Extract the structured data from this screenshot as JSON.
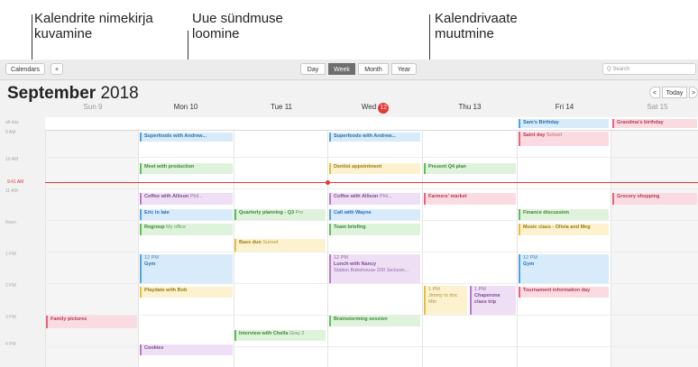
{
  "callouts": {
    "calendars_list": "Kalendrite nimekirja kuvamine",
    "new_event": "Uue sündmuse loomine",
    "change_view": "Kalendrivaate muutmine"
  },
  "toolbar": {
    "calendars_label": "Calendars",
    "add_label": "+",
    "views": [
      "Day",
      "Week",
      "Month",
      "Year"
    ],
    "active_view": "Week",
    "search_placeholder": "Q Search"
  },
  "header": {
    "month": "September",
    "year": "2018",
    "today_label": "Today",
    "prev_label": "<",
    "next_label": ">"
  },
  "days": [
    {
      "label": "Sun 9"
    },
    {
      "label": "Mon 10"
    },
    {
      "label": "Tue 11"
    },
    {
      "label": "Wed",
      "badge": "12"
    },
    {
      "label": "Thu 13"
    },
    {
      "label": "Fri 14"
    },
    {
      "label": "Sat 15"
    }
  ],
  "time_labels": [
    "all-day",
    "9 AM",
    "10 AM",
    "11 AM",
    "Noon",
    "1 PM",
    "2 PM",
    "3 PM",
    "4 PM"
  ],
  "now_label": "9:41 AM",
  "events": {
    "sams_birthday": {
      "title": "Sam's Birthday"
    },
    "grandma_birthday": {
      "title": "Grandma's birthday"
    },
    "superfoods_mon": {
      "title": "Superfoods with Andrew..."
    },
    "superfoods_wed": {
      "title": "Superfoods with Andrew..."
    },
    "saint_day": {
      "title": "Saint day",
      "sub": "School"
    },
    "meet_production": {
      "title": "Meet with production"
    },
    "dentist": {
      "title": "Dentist appointment"
    },
    "present_q4": {
      "title": "Present Q4 plan"
    },
    "coffee_mon": {
      "title": "Coffee with Allison",
      "sub": "Phil..."
    },
    "coffee_wed": {
      "title": "Coffee with Allison",
      "sub": "Phil..."
    },
    "farmers_market": {
      "title": "Farmers' market"
    },
    "grocery": {
      "title": "Grocery shopping"
    },
    "eric_late": {
      "title": "Eric in late"
    },
    "quarterly": {
      "title": "Quarterly planning - Q3",
      "sub": "Pro"
    },
    "call_wayne": {
      "title": "Call with Wayne"
    },
    "finance": {
      "title": "Finance discussion"
    },
    "regroup": {
      "title": "Regroup",
      "sub": "My office"
    },
    "team_briefing": {
      "title": "Team briefing"
    },
    "music_class": {
      "title": "Music class - Olivia and Meg"
    },
    "bass_duo": {
      "title": "Bass duo",
      "sub": "Sunset"
    },
    "gym_mon": {
      "time": "12 PM",
      "title": "Gym"
    },
    "lunch_nancy": {
      "time": "12 PM",
      "title": "Lunch with Nancy",
      "sub": "Station Bakehouse 200 Jackson..."
    },
    "gym_fri": {
      "time": "12 PM",
      "title": "Gym"
    },
    "pizza": {
      "title": "Playdate with Bob"
    },
    "jimmy": {
      "time": "1 PM",
      "title": "Jimmy to doc",
      "sub": "Mtn"
    },
    "chaperone": {
      "time": "1 PM",
      "title": "Chaperone class trip"
    },
    "tournament": {
      "title": "Tournament information day"
    },
    "family_pictures": {
      "title": "Family pictures"
    },
    "brainstorm": {
      "title": "Brainstorming session"
    },
    "interview": {
      "title": "Interview with Chella",
      "sub": "Gray 2"
    },
    "cookies": {
      "title": "Cookies"
    }
  }
}
